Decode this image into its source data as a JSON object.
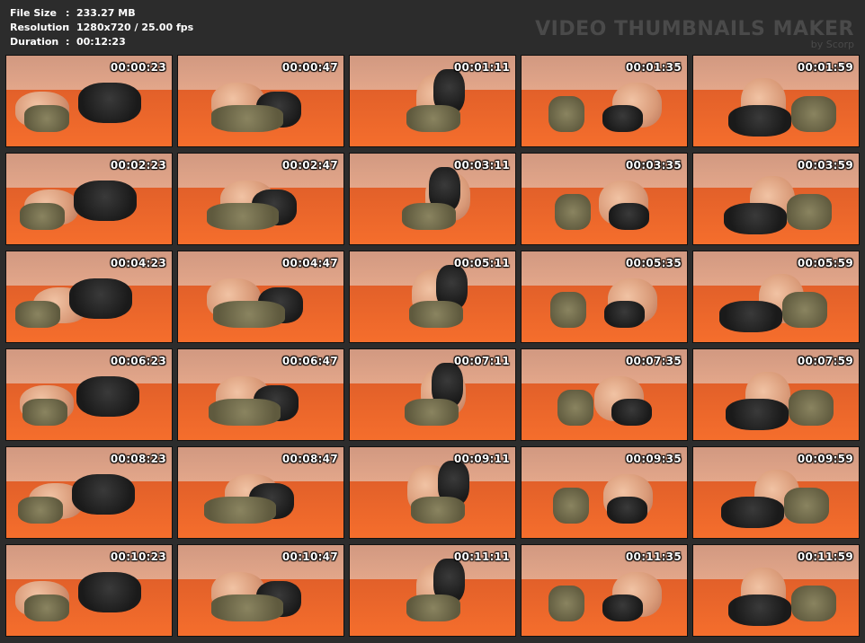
{
  "info": {
    "file_size_label": "File Size",
    "file_size_value": "233.27 MB",
    "resolution_label": "Resolution",
    "resolution_value": "1280x720 / 25.00 fps",
    "duration_label": "Duration",
    "duration_value": "00:12:23",
    "separator": ":"
  },
  "brand": {
    "title": "VIDEO THUMBNAILS MAKER",
    "subtitle": "by Scorp"
  },
  "thumbnails": [
    "00:00:23",
    "00:00:47",
    "00:01:11",
    "00:01:35",
    "00:01:59",
    "00:02:23",
    "00:02:47",
    "00:03:11",
    "00:03:35",
    "00:03:59",
    "00:04:23",
    "00:04:47",
    "00:05:11",
    "00:05:35",
    "00:05:59",
    "00:06:23",
    "00:06:47",
    "00:07:11",
    "00:07:35",
    "00:07:59",
    "00:08:23",
    "00:08:47",
    "00:09:11",
    "00:09:35",
    "00:09:59",
    "00:10:23",
    "00:10:47",
    "00:11:11",
    "00:11:35",
    "00:11:59"
  ]
}
